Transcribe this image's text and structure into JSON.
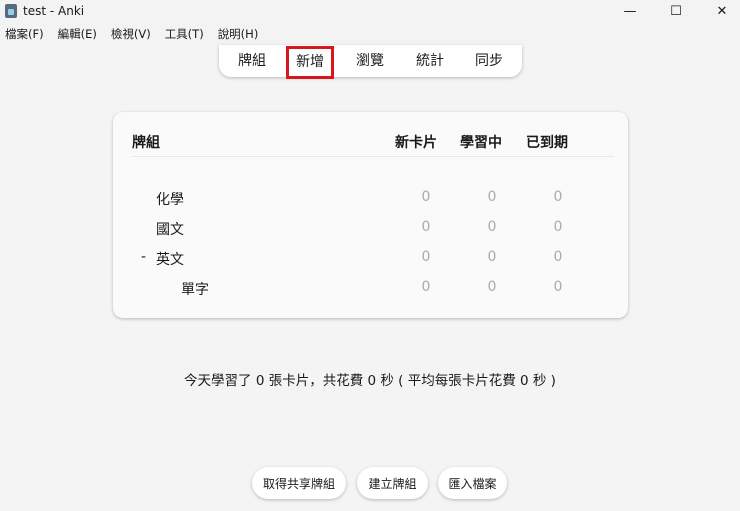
{
  "window": {
    "title": "test - Anki",
    "minimize": "—",
    "maximize": "☐",
    "close": "✕"
  },
  "menu": [
    "檔案(F)",
    "編輯(E)",
    "檢視(V)",
    "工具(T)",
    "說明(H)"
  ],
  "toolbar": [
    "牌組",
    "新增",
    "瀏覽",
    "統計",
    "同步"
  ],
  "table": {
    "headers": [
      "牌組",
      "新卡片",
      "學習中",
      "已到期"
    ],
    "rows": [
      {
        "prefix": "",
        "name": "化學",
        "new": "0",
        "learn": "0",
        "due": "0",
        "indent": 0
      },
      {
        "prefix": "",
        "name": "國文",
        "new": "0",
        "learn": "0",
        "due": "0",
        "indent": 0
      },
      {
        "prefix": "-",
        "name": "英文",
        "new": "0",
        "learn": "0",
        "due": "0",
        "indent": 0
      },
      {
        "prefix": "",
        "name": "單字",
        "new": "0",
        "learn": "0",
        "due": "0",
        "indent": 1
      }
    ]
  },
  "stats": "今天學習了 0 張卡片，共花費 0 秒 ( 平均每張卡片花費 0 秒 )",
  "buttons": [
    "取得共享牌組",
    "建立牌組",
    "匯入檔案"
  ],
  "colors": {
    "highlight": "#d9161c"
  }
}
